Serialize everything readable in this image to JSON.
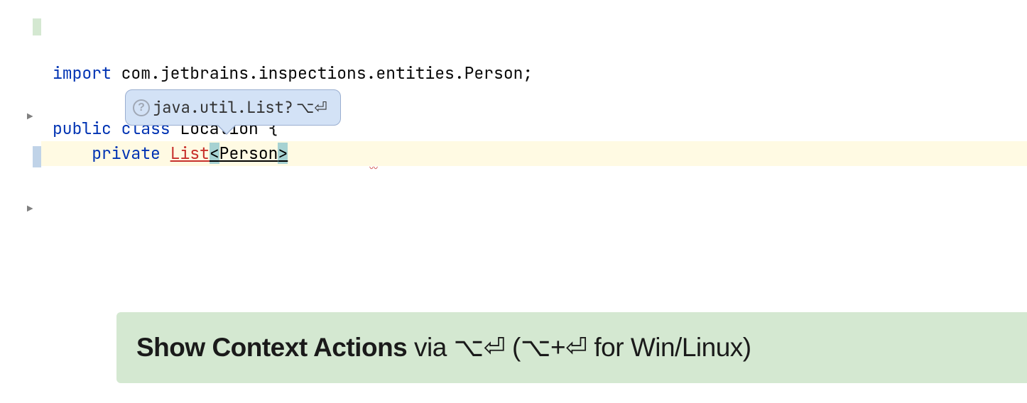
{
  "code": {
    "line1": {
      "import_kw": "import",
      "import_path": " com.jetbrains.inspections.entities.Person;"
    },
    "line2": {
      "public_kw": "public class",
      "class_name": " Location ",
      "brace": "{"
    },
    "line3": {
      "indent": "    ",
      "private_kw": "private",
      "space": " ",
      "list_type": "List",
      "lt": "<",
      "person_type": "Person",
      "gt": ">"
    }
  },
  "tooltip": {
    "text": "java.util.List? ",
    "shortcut": "⌥⏎"
  },
  "hint": {
    "bold": "Show Context Actions",
    "rest": " via ⌥⏎ (⌥+⏎ for Win/Linux)"
  },
  "squiggle": "〰"
}
